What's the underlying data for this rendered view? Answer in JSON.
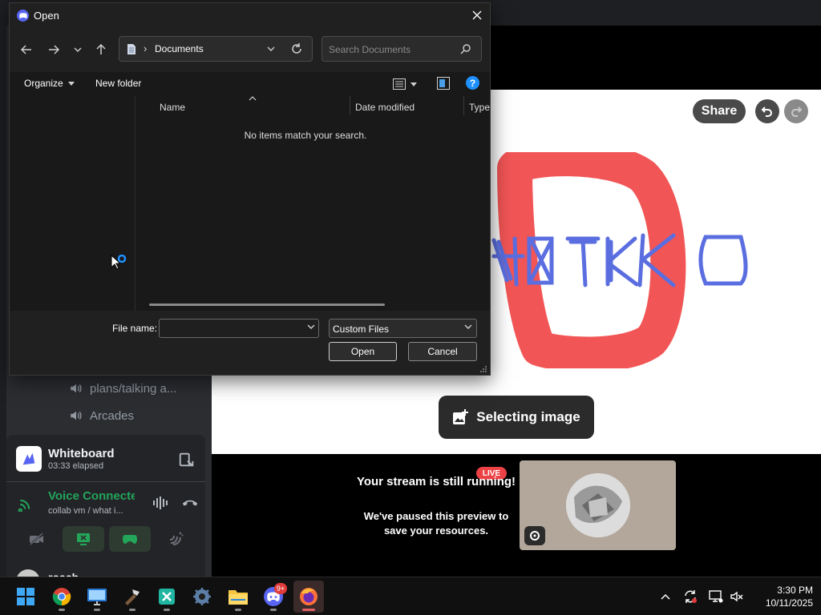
{
  "dialog": {
    "title": "Open",
    "address": {
      "folder": "Documents"
    },
    "search": {
      "placeholder": "Search Documents"
    },
    "toolbar": {
      "organize": "Organize",
      "new_folder": "New folder"
    },
    "columns": [
      "Name",
      "Date modified",
      "Type"
    ],
    "empty_message": "No items match your search.",
    "file_name_label": "File name:",
    "file_name_value": "",
    "file_type": "Custom Files",
    "open_label": "Open",
    "cancel_label": "Cancel"
  },
  "discord": {
    "channels": [
      {
        "name": "plans/talking a..."
      },
      {
        "name": "Arcades"
      }
    ],
    "activity": {
      "title": "Whiteboard",
      "elapsed": "03:33 elapsed"
    },
    "voice": {
      "status": "Voice Connecte",
      "location": "collab vm / what i..."
    },
    "peek_user": "roach",
    "whiteboard": {
      "share_label": "Share",
      "selecting_label": "Selecting image",
      "drawing_letter": "D"
    },
    "stream": {
      "live_label": "LIVE",
      "title": "Your stream is still running!",
      "subtitle": "We've paused this preview to save your resources."
    }
  },
  "taskbar": {
    "apps": [
      "windows-start",
      "chrome",
      "remote-desktop",
      "file-manager-tool",
      "vscode-insiders",
      "settings",
      "file-explorer",
      "discord",
      "firefox"
    ],
    "discord_badge": "9+",
    "time": "3:30 PM",
    "date": "10/11/2025"
  },
  "colors": {
    "accent_blue": "#1e90ff",
    "discord_blurple": "#5865f2",
    "voice_green": "#23a55a",
    "live_red": "#ed4245",
    "drawing_red": "#f25555",
    "drawing_blue": "#5b6ee0"
  }
}
